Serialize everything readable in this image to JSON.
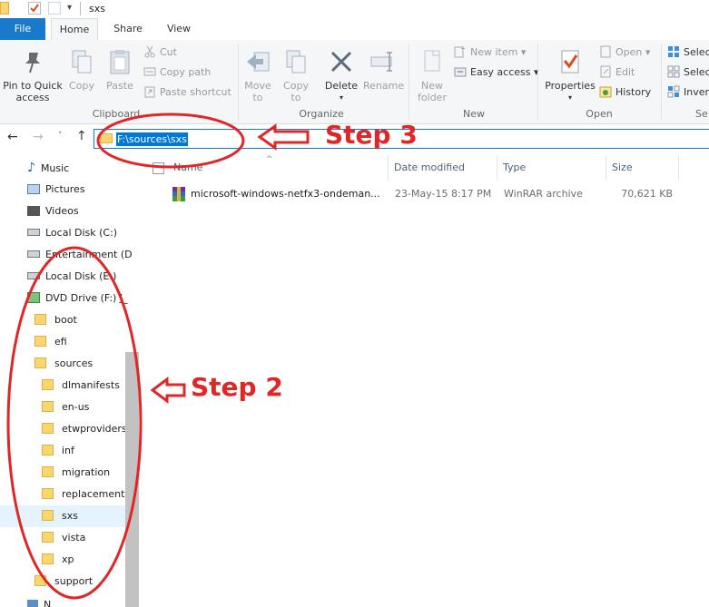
{
  "window": {
    "title": "sxs"
  },
  "tabs": [
    {
      "label": "File"
    },
    {
      "label": "Home"
    },
    {
      "label": "Share"
    },
    {
      "label": "View"
    }
  ],
  "ribbon": {
    "clipboard": {
      "label": "Clipboard",
      "pin": "Pin to Quick\naccess",
      "copy": "Copy",
      "paste": "Paste",
      "cut": "Cut",
      "copy_path": "Copy path",
      "paste_shortcut": "Paste shortcut"
    },
    "organize": {
      "label": "Organize",
      "move_to": "Move\nto",
      "copy_to": "Copy\nto",
      "delete": "Delete",
      "rename": "Rename"
    },
    "new": {
      "label": "New",
      "new_folder": "New\nfolder",
      "new_item": "New item",
      "easy_access": "Easy access"
    },
    "open": {
      "label": "Open",
      "properties": "Properties",
      "open": "Open",
      "edit": "Edit",
      "history": "History"
    },
    "select": {
      "label": "Se",
      "select_all": "Selec",
      "select_none": "Selec",
      "invert": "Inver"
    }
  },
  "address": {
    "path": "F:\\sources\\sxs"
  },
  "nav_pane": [
    {
      "label": "Music"
    },
    {
      "label": "Pictures"
    },
    {
      "label": "Videos"
    },
    {
      "label": "Local Disk (C:)"
    },
    {
      "label": "Entertainment (D"
    },
    {
      "label": "Local Disk (E:)"
    },
    {
      "label": "DVD Drive (F:) J_"
    },
    {
      "label": "boot"
    },
    {
      "label": "efi"
    },
    {
      "label": "sources"
    },
    {
      "label": "dlmanifests"
    },
    {
      "label": "en-us"
    },
    {
      "label": "etwproviders"
    },
    {
      "label": "inf"
    },
    {
      "label": "migration"
    },
    {
      "label": "replacementr"
    },
    {
      "label": "sxs"
    },
    {
      "label": "vista"
    },
    {
      "label": "xp"
    },
    {
      "label": "support"
    },
    {
      "label": "N"
    }
  ],
  "columns": {
    "name": "Name",
    "date": "Date modified",
    "type": "Type",
    "size": "Size"
  },
  "files": [
    {
      "name": "microsoft-windows-netfx3-ondeman...",
      "date": "23-May-15 8:17 PM",
      "type": "WinRAR archive",
      "size": "70,621 KB"
    }
  ],
  "annotations": {
    "step3": "Step 3",
    "step2": "Step 2"
  },
  "colors": {
    "accent": "#1979ca",
    "selection": "#0078d7",
    "annotation": "#e02626",
    "folder": "#fbd56d"
  }
}
